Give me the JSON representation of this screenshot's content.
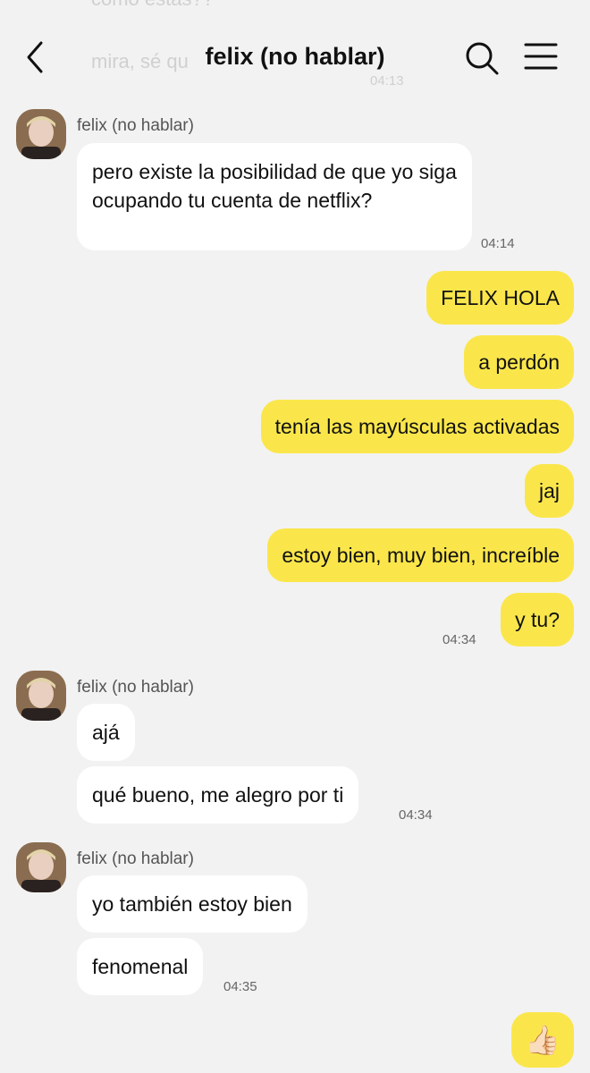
{
  "ghost": {
    "line1": "como estas??",
    "line2": "mira, sé qu",
    "time": "04:13"
  },
  "header": {
    "title": "felix (no hablar)"
  },
  "contact": {
    "name": "felix (no hablar)"
  },
  "groups": [
    {
      "messages": [
        "pero existe la posibilidad de que yo siga ocupando tu cuenta de netflix?"
      ],
      "time": "04:14"
    },
    {
      "messages": [
        "FELIX HOLA",
        "a perdón",
        "tenía las mayúsculas activadas",
        "jaj",
        "estoy bien, muy bien, increíble",
        "y tu?"
      ],
      "time": "04:34"
    },
    {
      "messages": [
        "ajá",
        "qué bueno, me alegro por ti"
      ],
      "time": "04:34"
    },
    {
      "messages": [
        "yo también estoy bien",
        "fenomenal"
      ],
      "time": "04:35"
    },
    {
      "messages": [
        "👍🏻"
      ]
    }
  ],
  "icons": {
    "back": "chevron-left-icon",
    "search": "search-icon",
    "menu": "hamburger-menu-icon",
    "reaction": "thumbs-up-emoji"
  },
  "colors": {
    "background": "#f2f2f2",
    "outgoing_bubble": "#fae64b",
    "incoming_bubble": "#ffffff"
  }
}
